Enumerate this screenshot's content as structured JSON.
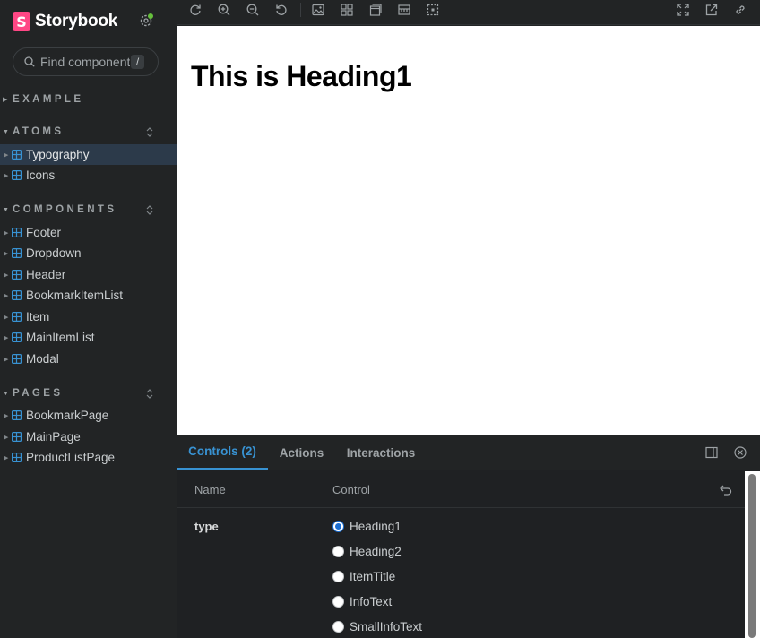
{
  "brand": {
    "logo_letter": "S",
    "name": "Storybook"
  },
  "search": {
    "placeholder": "Find components",
    "shortcut": "/"
  },
  "sidebar": {
    "groups": [
      {
        "title": "EXAMPLE",
        "items": []
      },
      {
        "title": "ATOMS",
        "items": [
          {
            "label": "Typography",
            "active": true
          },
          {
            "label": "Icons"
          }
        ]
      },
      {
        "title": "COMPONENTS",
        "items": [
          {
            "label": "Footer"
          },
          {
            "label": "Dropdown"
          },
          {
            "label": "Header"
          },
          {
            "label": "BookmarkItemList"
          },
          {
            "label": "Item"
          },
          {
            "label": "MainItemList"
          },
          {
            "label": "Modal"
          }
        ]
      },
      {
        "title": "PAGES",
        "items": [
          {
            "label": "BookmarkPage"
          },
          {
            "label": "MainPage"
          },
          {
            "label": "ProductListPage"
          }
        ]
      }
    ]
  },
  "preview": {
    "heading": "This is Heading1"
  },
  "panel": {
    "tabs": [
      {
        "label": "Controls (2)",
        "active": true
      },
      {
        "label": "Actions"
      },
      {
        "label": "Interactions"
      }
    ],
    "columns": {
      "name": "Name",
      "control": "Control"
    },
    "row": {
      "name": "type",
      "options": [
        "Heading1",
        "Heading2",
        "ItemTitle",
        "InfoText",
        "SmallInfoText"
      ],
      "selected": "Heading1"
    }
  },
  "colors": {
    "accent": "#3892d2",
    "brand": "#ff4785",
    "status": "#66bf3c",
    "active_item_bg": "#2c3a4a"
  }
}
